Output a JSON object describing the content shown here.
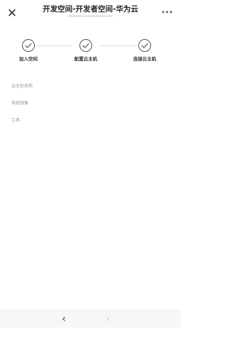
{
  "header": {
    "title": "开发空间-开发者空间-华为云",
    "subtitle": "developer.huaweicloud.com",
    "close_icon": "close-icon",
    "more_icon": "more-icon"
  },
  "steps": [
    {
      "label": "加入空间",
      "icon": "check-circle-icon"
    },
    {
      "label": "配置云主机",
      "icon": "check-circle-icon"
    },
    {
      "label": "连接云主机",
      "icon": "check-circle-icon"
    }
  ],
  "fields": [
    {
      "label": "云主机名称"
    },
    {
      "label": "系统镜像"
    },
    {
      "label": "工具"
    }
  ],
  "bottom_nav": {
    "back_icon": "chevron-left-icon",
    "forward_icon": "chevron-right-icon"
  },
  "colors": {
    "step_stroke": "#555555",
    "step_line": "#dddddd",
    "muted_text": "#999999",
    "bottom_bar": "#f7f7f7"
  }
}
